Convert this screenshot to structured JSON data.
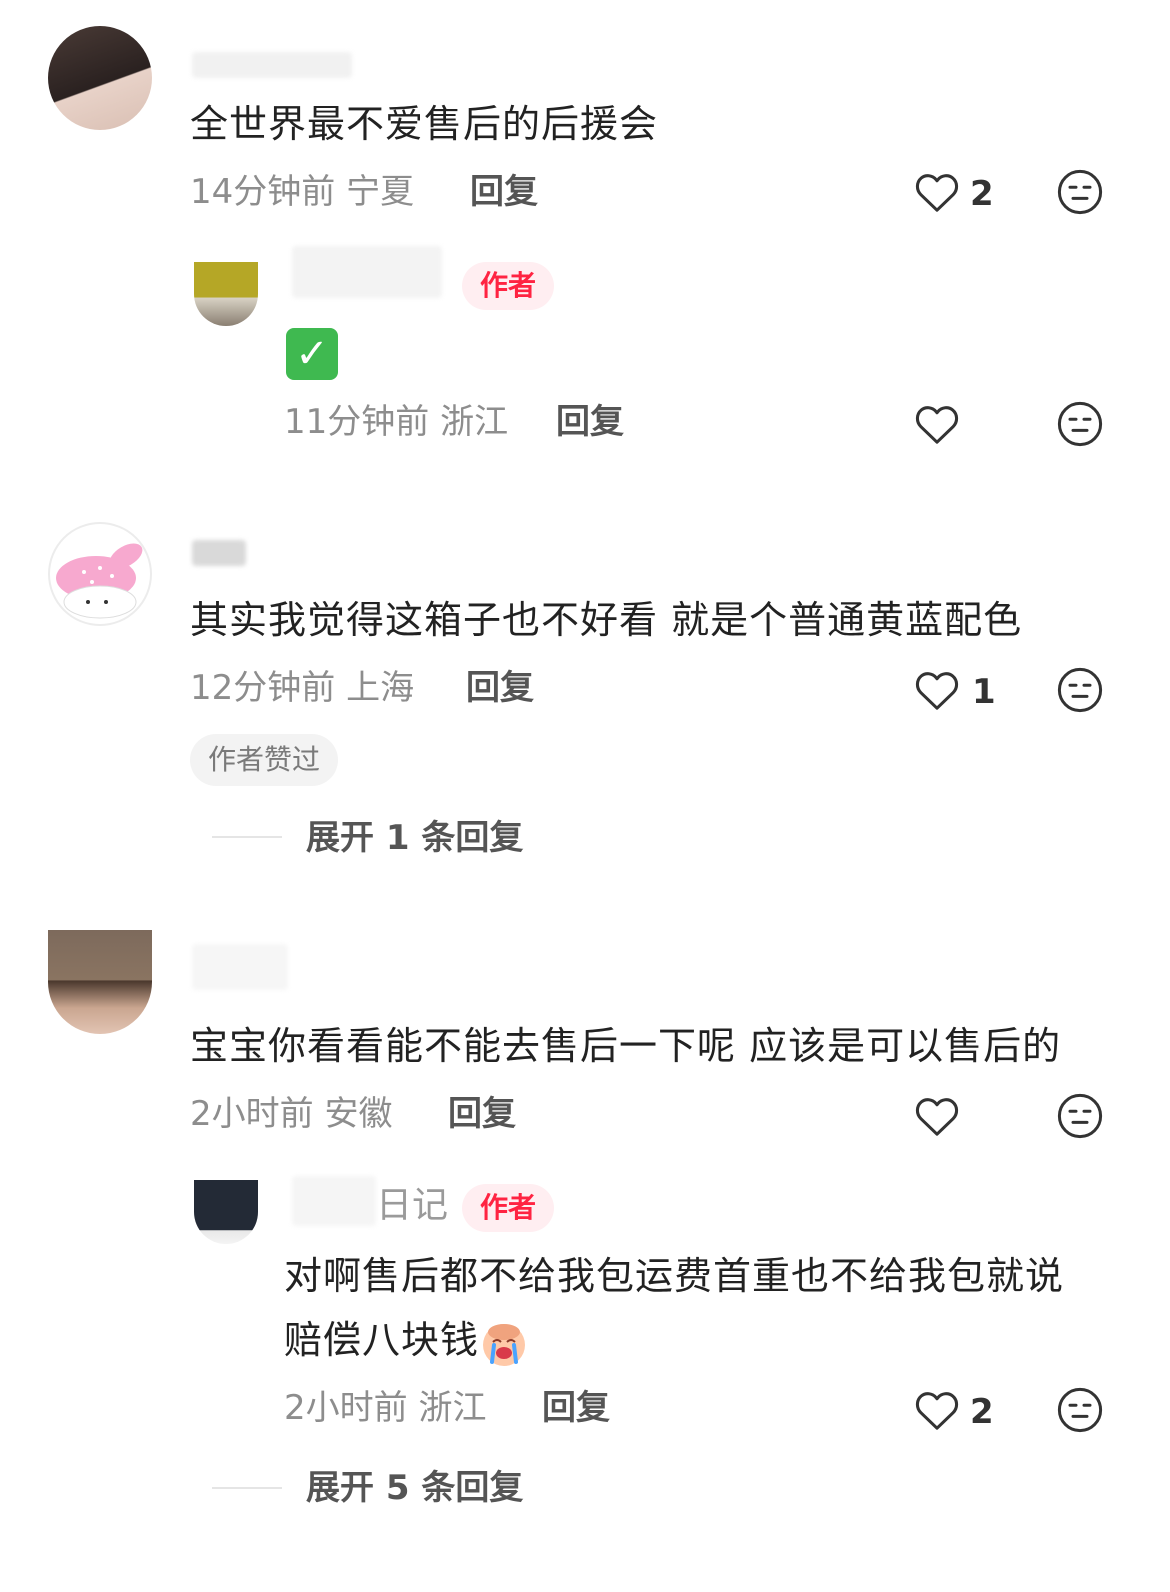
{
  "comments": [
    {
      "username": "",
      "text": "全世界最不爱售后的后援会",
      "time": "14分钟前",
      "location": "宁夏",
      "reply_label": "回复",
      "likes": "2",
      "replies": [
        {
          "username": "",
          "badge": "作者",
          "text": "✓",
          "time": "11分钟前",
          "location": "浙江",
          "reply_label": "回复",
          "likes": ""
        }
      ]
    },
    {
      "username": "",
      "text": "其实我觉得这箱子也不好看 就是个普通黄蓝配色",
      "time": "12分钟前",
      "location": "上海",
      "reply_label": "回复",
      "likes": "1",
      "liked_by_author": "作者赞过",
      "expand_label": "展开 1 条回复"
    },
    {
      "username": "",
      "text": "宝宝你看看能不能去售后一下呢 应该是可以售后的",
      "time": "2小时前",
      "location": "安徽",
      "reply_label": "回复",
      "likes": "",
      "replies": [
        {
          "username": "日记",
          "badge": "作者",
          "text_line1": "对啊售后都不给我包运费首重也不给我包就说",
          "text_line2": "赔偿八块钱",
          "emoji": "crying-face-emoji",
          "time": "2小时前",
          "location": "浙江",
          "reply_label": "回复",
          "likes": "2"
        }
      ],
      "expand_label": "展开 5 条回复"
    }
  ],
  "icons": {
    "like": "heart-outline-icon",
    "dislike": "neutral-face-icon"
  },
  "colors": {
    "accent": "#ff2442",
    "meta_gray": "#8d8d8d"
  }
}
